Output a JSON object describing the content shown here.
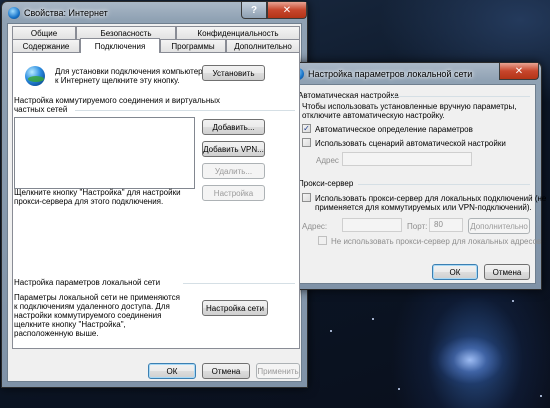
{
  "main_window": {
    "title": "Свойства: Интернет",
    "help_glyph": "?",
    "close_glyph": "✕",
    "tabs_row1": [
      "Общие",
      "Безопасность",
      "Конфиденциальность"
    ],
    "tabs_row2": [
      "Содержание",
      "Подключения",
      "Программы",
      "Дополнительно"
    ],
    "active_tab": "Подключения",
    "setup_text_1": "Для установки подключения компьютера",
    "setup_text_2": "к Интернету щелкните эту кнопку.",
    "setup_button": "Установить",
    "dialup_header_1": "Настройка коммутируемого соединения и виртуальных",
    "dialup_header_2": "частных сетей",
    "add_button": "Добавить...",
    "add_vpn_button": "Добавить VPN...",
    "remove_button": "Удалить...",
    "settings_button": "Настройка",
    "proxy_hint_1": "Щелкните кнопку \"Настройка\" для настройки",
    "proxy_hint_2": "прокси-сервера для этого подключения.",
    "lan_header": "Настройка параметров локальной сети",
    "lan_text": [
      "Параметры локальной сети не применяются",
      "к подключениям удаленного доступа. Для",
      "настройки коммутируемого соединения",
      "щелкните кнопку \"Настройка\",",
      "расположенную выше."
    ],
    "lan_settings_button": "Настройка сети",
    "ok_button": "ОК",
    "cancel_button": "Отмена",
    "apply_button": "Применить"
  },
  "lan_dialog": {
    "title": "Настройка параметров локальной сети",
    "close_glyph": "✕",
    "auto_header": "Автоматическая настройка",
    "auto_text_1": "Чтобы использовать установленные вручную параметры,",
    "auto_text_2": "отключите автоматическую настройку.",
    "auto_detect_label": "Автоматическое определение параметров",
    "auto_detect_checked": true,
    "auto_script_label": "Использовать сценарий автоматической настройки",
    "auto_script_checked": false,
    "address_label": "Адрес",
    "address_value": "",
    "proxy_header": "Прокси-сервер",
    "use_proxy_label_1": "Использовать прокси-сервер для локальных подключений (не",
    "use_proxy_label_2": "применяется для коммутируемых или VPN-подключений).",
    "use_proxy_checked": false,
    "proxy_address_label": "Адрес:",
    "proxy_address_value": "",
    "port_label": "Порт:",
    "port_value": "80",
    "advanced_button": "Дополнительно",
    "bypass_label": "Не использовать прокси-сервер для локальных адресов",
    "bypass_checked": false,
    "ok_button": "ОК",
    "cancel_button": "Отмена"
  }
}
